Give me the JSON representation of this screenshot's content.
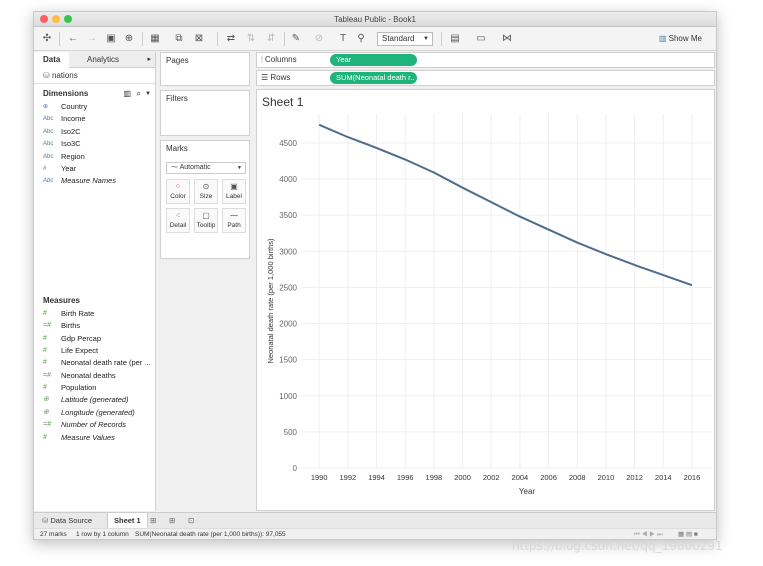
{
  "window": {
    "title": "Tableau Public - Book1"
  },
  "toolbar": {
    "fit_select": "Standard",
    "show_me_label": "Show Me"
  },
  "data_pane": {
    "tabs": [
      "Data",
      "Analytics"
    ],
    "datasource": "nations",
    "dimensions_title": "Dimensions",
    "dimensions": [
      {
        "type": "globe",
        "label": "Country",
        "italic": false
      },
      {
        "type": "Abc",
        "label": "Income",
        "italic": false
      },
      {
        "type": "Abc",
        "label": "Iso2C",
        "italic": false
      },
      {
        "type": "Abc",
        "label": "Iso3C",
        "italic": false
      },
      {
        "type": "Abc",
        "label": "Region",
        "italic": false
      },
      {
        "type": "num",
        "label": "Year",
        "italic": false
      },
      {
        "type": "Abc",
        "label": "Measure Names",
        "italic": true
      }
    ],
    "measures_title": "Measures",
    "measures": [
      {
        "type": "num",
        "label": "Birth Rate",
        "italic": false
      },
      {
        "type": "numcalc",
        "label": "Births",
        "italic": false
      },
      {
        "type": "num",
        "label": "Gdp Percap",
        "italic": false
      },
      {
        "type": "num",
        "label": "Life Expect",
        "italic": false
      },
      {
        "type": "num",
        "label": "Neonatal death rate (per ...",
        "italic": false
      },
      {
        "type": "numcalc",
        "label": "Neonatal deaths",
        "italic": false
      },
      {
        "type": "num",
        "label": "Population",
        "italic": false
      },
      {
        "type": "globe",
        "label": "Latitude (generated)",
        "italic": true
      },
      {
        "type": "globe",
        "label": "Longitude (generated)",
        "italic": true
      },
      {
        "type": "numcalc",
        "label": "Number of Records",
        "italic": true
      },
      {
        "type": "num",
        "label": "Measure Values",
        "italic": true
      }
    ]
  },
  "cards": {
    "pages": "Pages",
    "filters": "Filters",
    "marks": "Marks",
    "mark_type": "Automatic",
    "mark_buttons": [
      "Color",
      "Size",
      "Label",
      "Detail",
      "Tooltip",
      "Path"
    ]
  },
  "shelves": {
    "columns_label": "Columns",
    "columns_pill": "Year",
    "rows_label": "Rows",
    "rows_pill": "SUM(Neonatal death r.."
  },
  "sheet": {
    "title": "Sheet 1"
  },
  "chart_data": {
    "type": "line",
    "title": "",
    "xlabel": "Year",
    "ylabel": "Neonatal death rate (per 1,000 births)",
    "x": [
      1990,
      1992,
      1994,
      1996,
      1998,
      2000,
      2002,
      2004,
      2006,
      2008,
      2010,
      2012,
      2014,
      2016
    ],
    "series": [
      {
        "values": [
          4750,
          4580,
          4430,
          4270,
          4090,
          3880,
          3680,
          3480,
          3300,
          3120,
          2960,
          2810,
          2670,
          2530
        ]
      }
    ],
    "xlim": [
      1988.8,
      2017.4
    ],
    "ylim": [
      0,
      4900
    ],
    "yticks": [
      0,
      500,
      1000,
      1500,
      2000,
      2500,
      3000,
      3500,
      4000,
      4500
    ],
    "grid": true,
    "line_color": "#4e6d8c"
  },
  "bottom_tabs": [
    "Data Source",
    "Sheet 1"
  ],
  "status": {
    "marks": "27 marks",
    "dims": "1 row by 1 column",
    "sum": "SUM(Neonatal death rate (per 1,000 births)): 97,055"
  },
  "watermark": "https://blog.csdn.net/qq_19600291"
}
